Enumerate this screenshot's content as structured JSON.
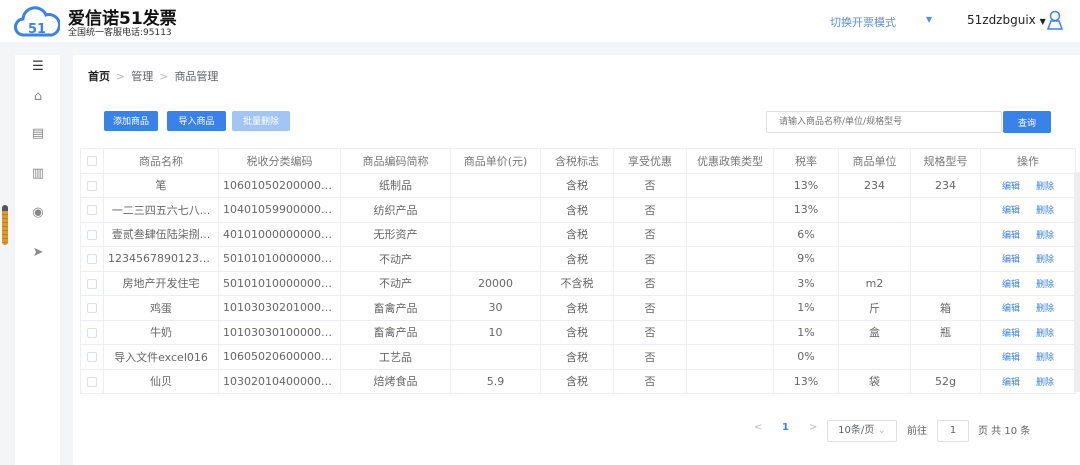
{
  "header": {
    "brand": "爱信诺51发票",
    "hotline": "全国统一客服电话:95113",
    "mode_label": "切换开票模式",
    "username": "51zdzbguix",
    "accent": "#3b82e8"
  },
  "breadcrumb": [
    "首页",
    "管理",
    "商品管理"
  ],
  "toolbar": {
    "add": "添加商品",
    "import": "导入商品",
    "batch_delete": "批量删除",
    "search_placeholder": "请输入商品名称/单位/规格型号",
    "query": "查询"
  },
  "table": {
    "columns": [
      "商品名称",
      "税收分类编码",
      "商品编码简称",
      "商品单价(元)",
      "含税标志",
      "享受优惠",
      "优惠政策类型",
      "税率",
      "商品单位",
      "规格型号",
      "操作"
    ],
    "actions": {
      "edit": "编辑",
      "delete": "删除"
    },
    "rows": [
      [
        "笔",
        "1060105020000000...",
        "纸制品",
        "",
        "含税",
        "否",
        "",
        "13%",
        "234",
        "234"
      ],
      [
        "一二三四五六七八...",
        "1040105990000000...",
        "纺织产品",
        "",
        "含税",
        "否",
        "",
        "13%",
        "",
        ""
      ],
      [
        "壹贰叁肆伍陆柒捌...",
        "4010100000000000...",
        "无形资产",
        "",
        "含税",
        "否",
        "",
        "6%",
        "",
        ""
      ],
      [
        "12345678901234...",
        "5010101000000000...",
        "不动产",
        "",
        "含税",
        "否",
        "",
        "9%",
        "",
        ""
      ],
      [
        "房地产开发住宅",
        "5010101000000000...",
        "不动产",
        "20000",
        "不含税",
        "否",
        "",
        "3%",
        "m2",
        ""
      ],
      [
        "鸡蛋",
        "1010303020100000...",
        "畜禽产品",
        "30",
        "含税",
        "否",
        "",
        "1%",
        "斤",
        "箱"
      ],
      [
        "牛奶",
        "1010303010000000...",
        "畜禽产品",
        "10",
        "含税",
        "否",
        "",
        "1%",
        "盒",
        "瓶"
      ],
      [
        "导入文件excel016",
        "1060502060000000...",
        "工艺品",
        "",
        "含税",
        "否",
        "",
        "0%",
        "",
        ""
      ],
      [
        "仙贝",
        "1030201040000000...",
        "焙烤食品",
        "5.9",
        "含税",
        "否",
        "",
        "13%",
        "袋",
        "52g"
      ]
    ]
  },
  "pagination": {
    "prev": "<",
    "current": "1",
    "next": ">",
    "page_size": "10条/页",
    "goto_label": "前往",
    "goto_value": "1",
    "total": "页 共 10 条"
  }
}
